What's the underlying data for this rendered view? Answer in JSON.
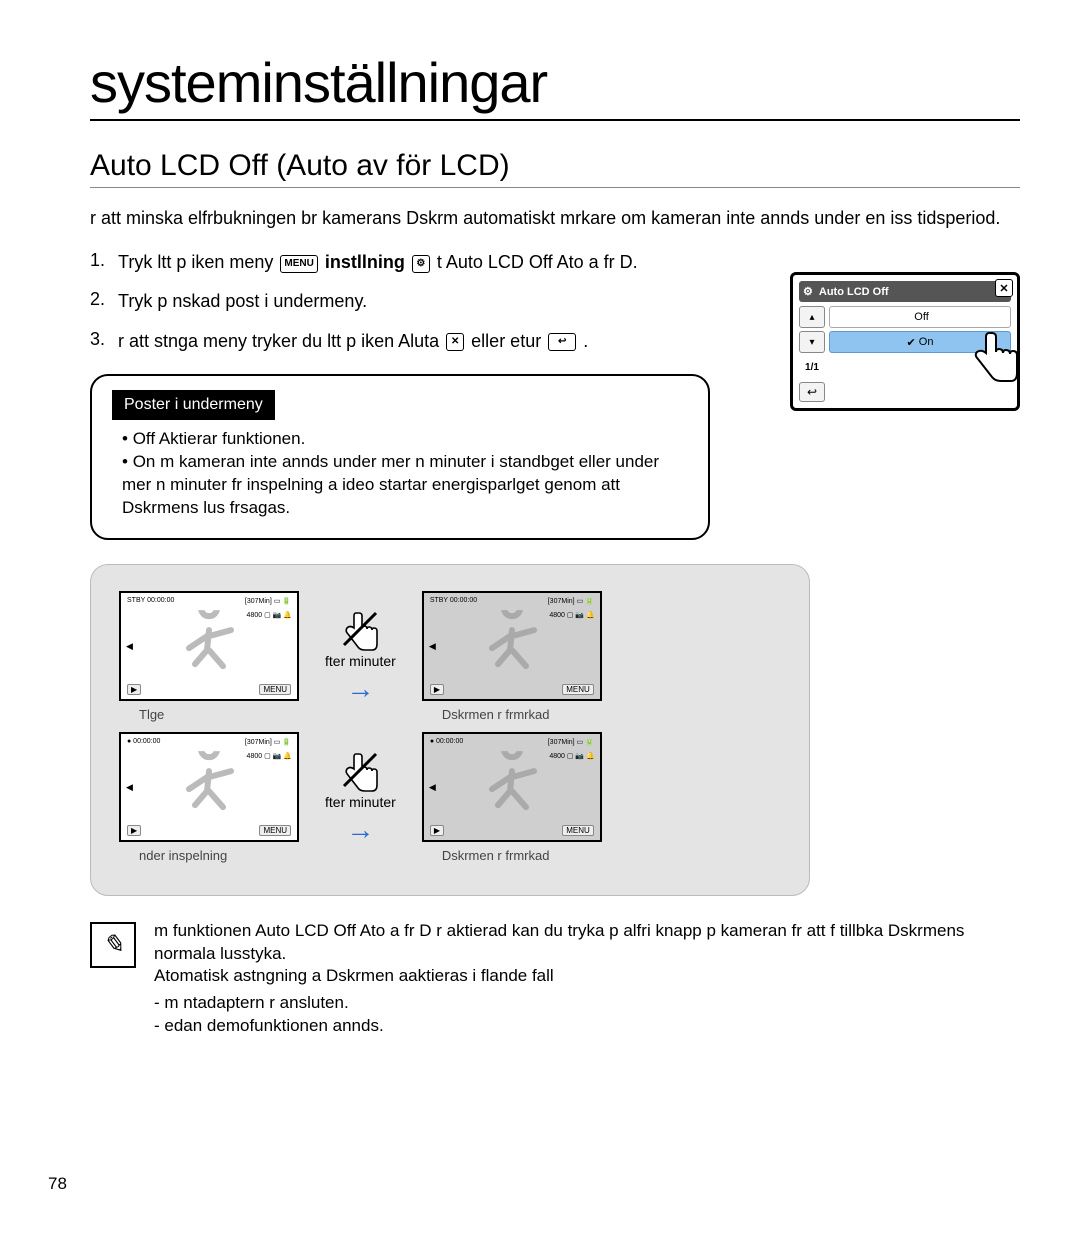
{
  "title": "systeminställningar",
  "subtitle": "Auto LCD Off (Auto av för LCD)",
  "intro": "r att minska elfrbukningen br kamerans Dskrm automatiskt mrkare om kameran inte annds under en iss tidsperiod.",
  "steps": [
    {
      "num": "1.",
      "pre": "Tryk ltt p iken meny ",
      "icon1": "MENU",
      "mid1": " ",
      "bold1": "instllning",
      "mid2": " ",
      "icon2": "⚙",
      "mid3": " t Auto LCD Off Ato a fr D."
    },
    {
      "num": "2.",
      "pre": "Tryk p nskad post i undermeny."
    },
    {
      "num": "3.",
      "pre": "r att stnga meny tryker du ltt p iken Aluta ",
      "icon1": "✕",
      "mid1": " eller etur ",
      "icon2": "↩",
      "mid2": "."
    }
  ],
  "menu": {
    "header_icon": "⚙",
    "header_text": "Auto LCD Off",
    "close": "✕",
    "up": "▴",
    "down": "▾",
    "page": "1/1",
    "items": [
      {
        "check": "",
        "label": "Off",
        "selected": false
      },
      {
        "check": "✔",
        "label": "On",
        "selected": true
      }
    ],
    "return": "↩"
  },
  "submenu": {
    "label": "Poster i undermeny",
    "items": [
      "Off Aktierar funktionen.",
      "On  m kameran inte annds under mer n  minuter i standbget eller under mer n  minuter fr inspelning a ideo startar energisparlget genom att Dskrmens lus frsagas."
    ]
  },
  "diagram": {
    "topbar_left": "STBY  00:00:00",
    "topbar_right": "[307Min] ▭ 🔋",
    "righticons": "4800 ▢ 📷 🔔",
    "bl": "▶",
    "br": "MENU",
    "mid_label": "fter  minuter",
    "captions": {
      "a": "Tlge",
      "b": "Dskrmen r frmrkad",
      "c": "nder inspelning",
      "d": "Dskrmen r frmrkad"
    },
    "rec_left": "●  00:00:00"
  },
  "note": {
    "p1_pre": "m funktionen ",
    "p1_bold": "Auto LCD Off Ato a fr D",
    "p1_post": " r aktierad kan du tryka p alfri knapp p kameran fr att f tillbka Dskrmens normala lusstyka.",
    "p2": "Atomatisk astngning a Dskrmen aaktieras i flande fall",
    "items": [
      "m ntadaptern r ansluten.",
      "edan demofunktionen annds."
    ]
  },
  "page_number": "78"
}
